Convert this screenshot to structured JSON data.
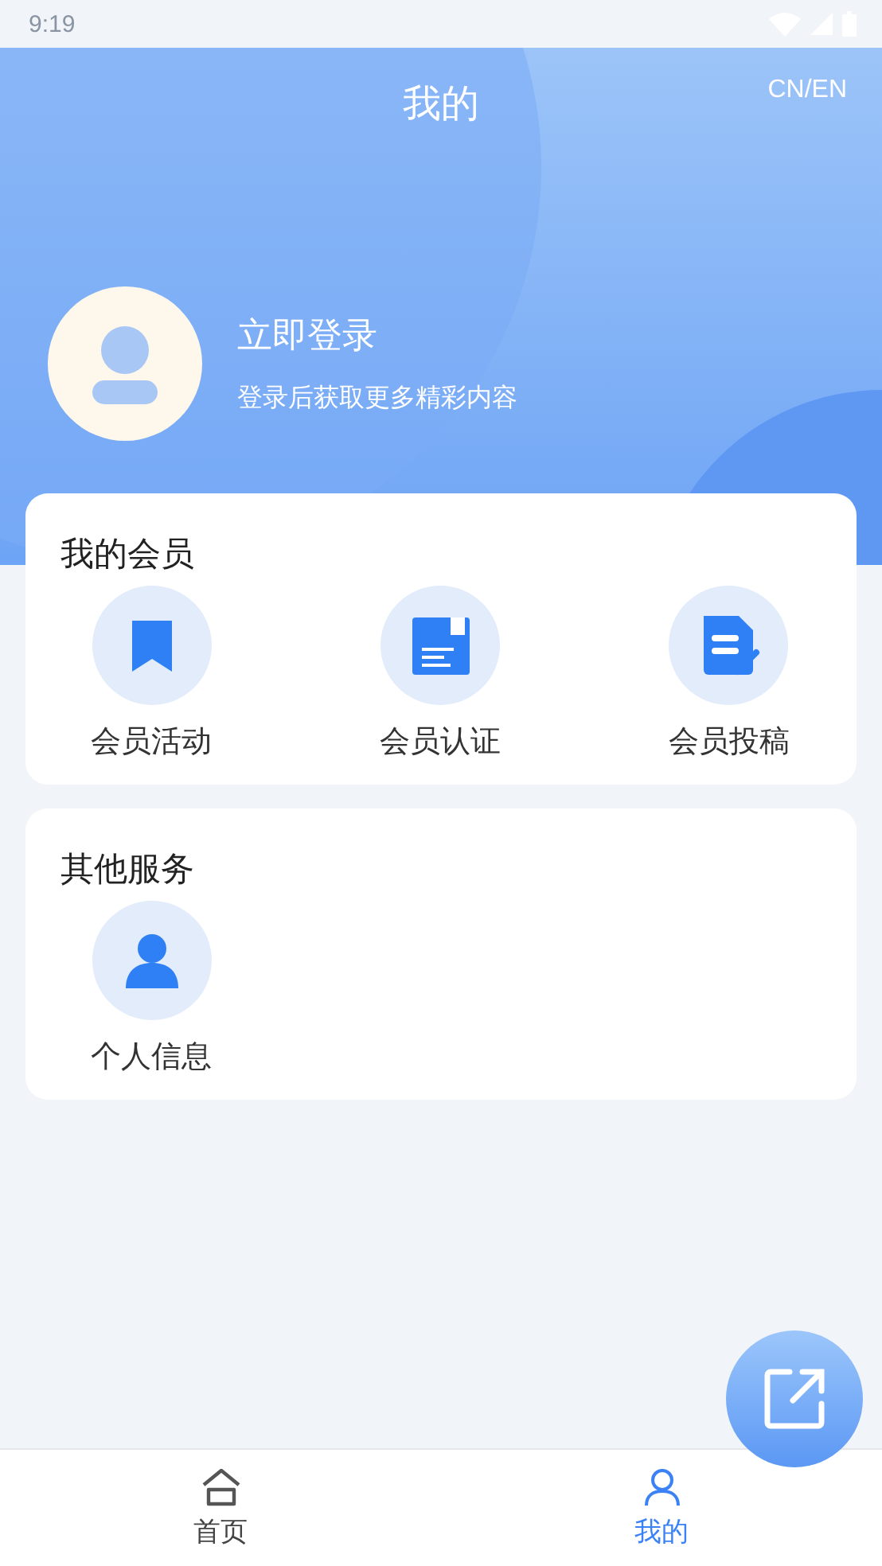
{
  "status_bar": {
    "time": "9:19"
  },
  "header": {
    "title": "我的",
    "language": "CN/EN"
  },
  "profile": {
    "name": "立即登录",
    "subtitle": "登录后获取更多精彩内容"
  },
  "sections": [
    {
      "title": "我的会员",
      "items": [
        {
          "label": "会员活动",
          "kind": "bookmark"
        },
        {
          "label": "会员认证",
          "kind": "certificate"
        },
        {
          "label": "会员投稿",
          "kind": "document"
        }
      ]
    },
    {
      "title": "其他服务",
      "items": [
        {
          "label": "个人信息",
          "kind": "person"
        }
      ]
    }
  ],
  "bottom_nav": [
    {
      "label": "首页",
      "kind": "home",
      "selected": false
    },
    {
      "label": "我的",
      "kind": "person",
      "selected": true
    }
  ]
}
